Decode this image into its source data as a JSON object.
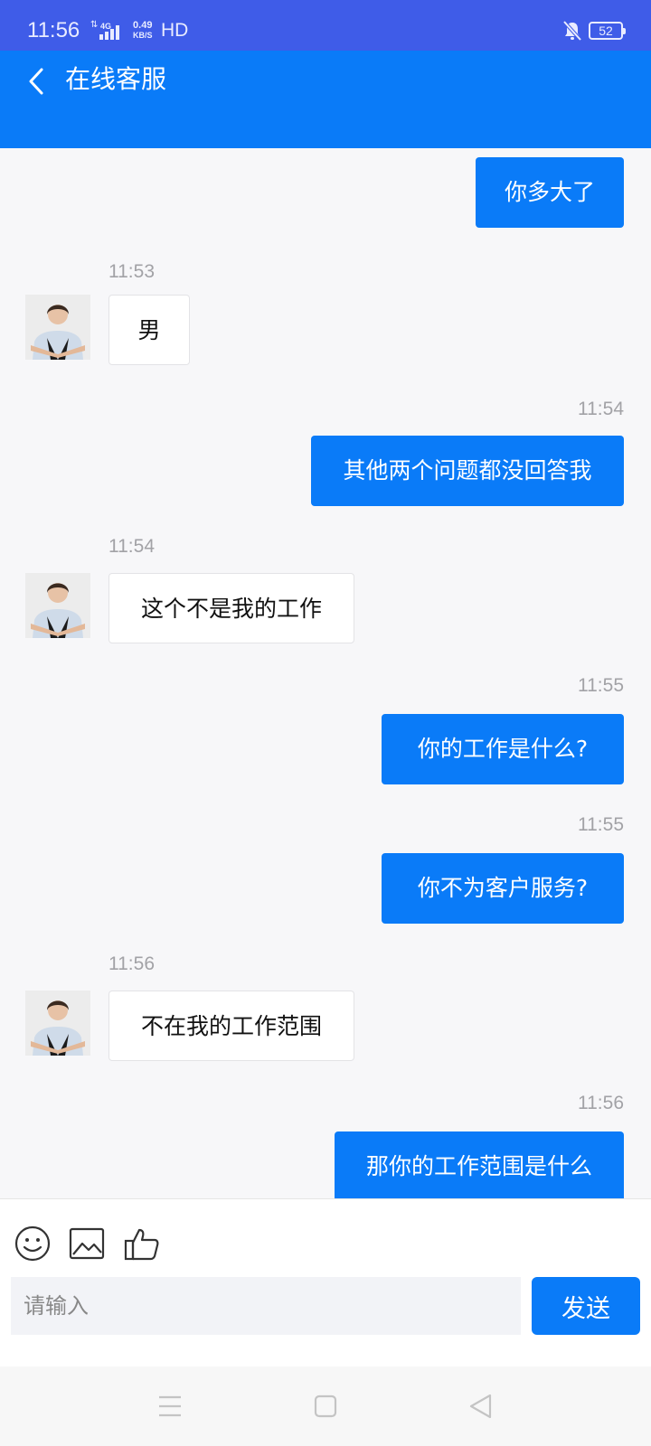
{
  "status_bar": {
    "time": "11:56",
    "network": "4G",
    "speed_value": "0.49",
    "speed_unit": "KB/S",
    "hd": "HD",
    "battery": "52"
  },
  "header": {
    "title": "在线客服"
  },
  "messages": [
    {
      "sender": "user",
      "text": "你多大了"
    },
    {
      "sender": "agent",
      "time": "11:53",
      "text": "男"
    },
    {
      "sender": "user",
      "time": "11:54",
      "text": "其他两个问题都没回答我"
    },
    {
      "sender": "agent",
      "time": "11:54",
      "text": "这个不是我的工作"
    },
    {
      "sender": "user",
      "time": "11:55",
      "text": "你的工作是什么?"
    },
    {
      "sender": "user",
      "time": "11:55",
      "text": "你不为客户服务?"
    },
    {
      "sender": "agent",
      "time": "11:56",
      "text": "不在我的工作范围"
    },
    {
      "sender": "user",
      "time": "11:56",
      "text": "那你的工作范围是什么"
    }
  ],
  "toolbar": {
    "icons": [
      "smiley-icon",
      "image-icon",
      "thumbs-up-icon"
    ]
  },
  "input": {
    "placeholder": "请输入",
    "value": ""
  },
  "send_label": "发送",
  "colors": {
    "status_bar": "#3f5ce8",
    "header": "#0a7bf8",
    "user_bubble": "#0a7bf8",
    "agent_bubble": "#ffffff",
    "background": "#f7f7f9"
  }
}
